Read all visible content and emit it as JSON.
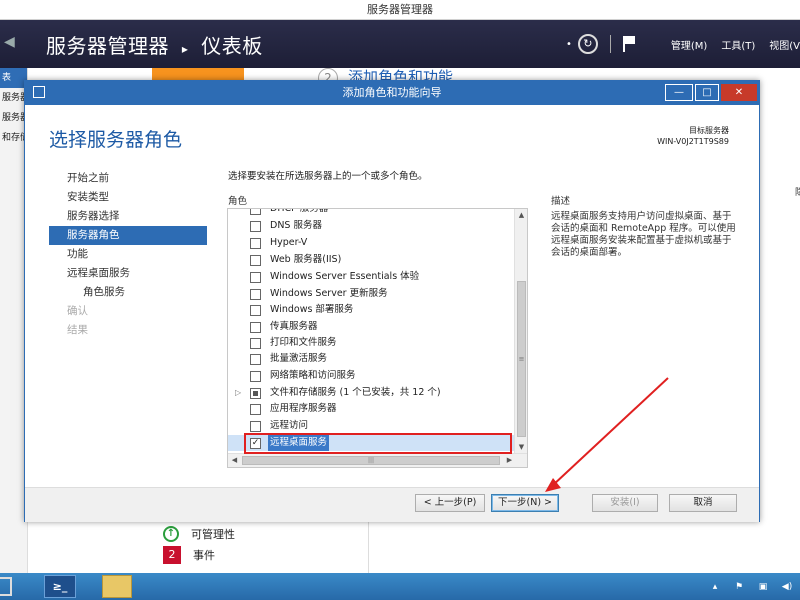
{
  "server_manager": {
    "window_title": "服务器管理器",
    "heading": "服务器管理器",
    "breadcrumb_separator": "▸",
    "heading_page": "仪表板",
    "menu_manage": "管理(M)",
    "menu_tools": "工具(T)",
    "menu_view": "视图(V",
    "left_items": [
      "表",
      "服务器",
      "服务器",
      "和存储"
    ],
    "step2_number": "2",
    "step2_label": "添加角色和功能",
    "manageability_label": "可管理性",
    "events_count": "2",
    "events_label": "事件",
    "right_edge_text": "隐"
  },
  "wizard": {
    "title": "添加角色和功能向导",
    "heading": "选择服务器角色",
    "target_label": "目标服务器",
    "target_server": "WIN-V0J2T1T9S89",
    "nav": [
      {
        "label": "开始之前",
        "state": "normal"
      },
      {
        "label": "安装类型",
        "state": "normal"
      },
      {
        "label": "服务器选择",
        "state": "normal"
      },
      {
        "label": "服务器角色",
        "state": "selected"
      },
      {
        "label": "功能",
        "state": "normal"
      },
      {
        "label": "远程桌面服务",
        "state": "normal"
      },
      {
        "label": "角色服务",
        "state": "sub"
      },
      {
        "label": "确认",
        "state": "disabled"
      },
      {
        "label": "结果",
        "state": "disabled"
      }
    ],
    "instruction": "选择要安装在所选服务器上的一个或多个角色。",
    "roles_header": "角色",
    "description_header": "描述",
    "description": "远程桌面服务支持用户访问虚拟桌面、基于会话的桌面和 RemoteApp 程序。可以使用远程桌面服务安装来配置基于虚拟机或基于会话的桌面部署。",
    "roles": [
      {
        "label": "DHCP 服务器",
        "checked": false,
        "cut": true
      },
      {
        "label": "DNS 服务器",
        "checked": false
      },
      {
        "label": "Hyper-V",
        "checked": false
      },
      {
        "label": "Web 服务器(IIS)",
        "checked": false
      },
      {
        "label": "Windows Server Essentials 体验",
        "checked": false
      },
      {
        "label": "Windows Server 更新服务",
        "checked": false
      },
      {
        "label": "Windows 部署服务",
        "checked": false
      },
      {
        "label": "传真服务器",
        "checked": false
      },
      {
        "label": "打印和文件服务",
        "checked": false
      },
      {
        "label": "批量激活服务",
        "checked": false
      },
      {
        "label": "网络策略和访问服务",
        "checked": false
      },
      {
        "label": "文件和存储服务 (1 个已安装，共 12 个)",
        "checked": "partial",
        "expandable": true
      },
      {
        "label": "应用程序服务器",
        "checked": false
      },
      {
        "label": "远程访问",
        "checked": false
      },
      {
        "label": "远程桌面服务",
        "checked": true,
        "selected": true
      }
    ],
    "buttons": {
      "prev": "< 上一步(P)",
      "next": "下一步(N) >",
      "install": "安装(I)",
      "cancel": "取消"
    }
  },
  "taskbar": {
    "powershell_label": "≥_"
  },
  "colors": {
    "accent": "#2d6cb4",
    "annotation": "#e02020",
    "header_bg": "#1f1f3a"
  }
}
